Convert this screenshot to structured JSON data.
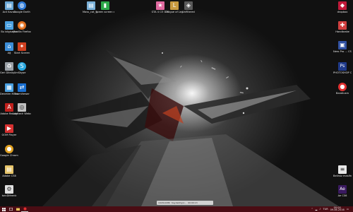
{
  "desktop": {
    "left_column": [
      {
        "label": "Acil Kavun",
        "icon": "folder-icon",
        "color": "#6aa7d6"
      },
      {
        "label": "Bu bilgisayar",
        "icon": "computer-icon",
        "color": "#4aa0e0"
      },
      {
        "label": "Ağ",
        "icon": "network-icon",
        "color": "#3c8ed8"
      },
      {
        "label": "Geri Dönüşüm Kutusu",
        "icon": "recycle-bin-icon",
        "color": "#9aa0a6"
      },
      {
        "label": "Denetim Masası",
        "icon": "control-panel-icon",
        "color": "#4aa0e0"
      },
      {
        "label": "Adobe Reader",
        "icon": "pdf-icon",
        "color": "#c0201c"
      },
      {
        "label": "GOM Player",
        "icon": "media-player-icon",
        "color": "#d63030"
      },
      {
        "label": "Google Chrome",
        "icon": "chrome-icon",
        "color": "#e0a020"
      },
      {
        "label": "Adobe CS6",
        "icon": "folder-icon",
        "color": "#e6c46a"
      },
      {
        "label": "lsecDifeenk",
        "icon": "app-icon",
        "color": "#e0e0e0"
      }
    ],
    "second_column": [
      {
        "label": "Google Earth",
        "icon": "earth-icon",
        "color": "#2f7bd8"
      },
      {
        "label": "Mozilla Firefox",
        "icon": "firefox-icon",
        "color": "#e07020"
      },
      {
        "label": "Start Screen",
        "icon": "grid-icon",
        "color": "#d04020"
      },
      {
        "label": "Skype",
        "icon": "skype-icon",
        "color": "#2aa8e0"
      },
      {
        "label": "TeamViewer",
        "icon": "teamviewer-icon",
        "color": "#1a6fd0"
      },
      {
        "label": "Logitech Webcam",
        "icon": "webcam-icon",
        "color": "#c0c0c0"
      }
    ],
    "top_row": [
      {
        "label": "Mass_cat_S...",
        "icon": "folder-icon",
        "color": "#7ab0d8"
      },
      {
        "label": "green screen darkmpower...",
        "icon": "video-icon",
        "color": "#2ea84a"
      },
      {
        "label": "GTA 4 CE OTE",
        "icon": "game-icon",
        "color": "#e06aa0"
      },
      {
        "label": "League of Legends",
        "icon": "lol-icon",
        "color": "#c89a40"
      },
      {
        "label": "Unfiltered",
        "icon": "app-icon",
        "color": "#5a5a5a"
      }
    ],
    "right_column": [
      {
        "label": "dropbox",
        "icon": "dropbox-icon",
        "color": "#c01a3a"
      },
      {
        "label": "Handbrake",
        "icon": "handbrake-icon",
        "color": "#d04040"
      },
      {
        "label": "Nero Pro ... CS6 (64 Bit)",
        "icon": "app-icon",
        "color": "#3050a0"
      },
      {
        "label": "PHOTOSHOP CS6",
        "icon": "photoshop-icon",
        "color": "#1f3a8a"
      },
      {
        "label": "Bandicam",
        "icon": "bandicam-icon",
        "color": "#e03030"
      },
      {
        "label": "Belirsiz masifnir txt",
        "icon": "text-file-icon",
        "color": "#e8e8e8"
      },
      {
        "label": "Ae CS6",
        "icon": "after-effects-icon",
        "color": "#3a1a60"
      }
    ]
  },
  "dock": {
    "items": [
      "1920x1080",
      "Kaydediliyor...",
      "00:00:13"
    ]
  },
  "taskbar": {
    "start_icon": "windows-icon",
    "apps": [
      {
        "icon": "task-view-icon"
      },
      {
        "icon": "file-explorer-icon"
      },
      {
        "icon": "bandicam-icon"
      }
    ],
    "tray": {
      "lang": "TUR",
      "time": "00:00",
      "date": "09.06.2016"
    },
    "accent": "#4a0d14"
  }
}
